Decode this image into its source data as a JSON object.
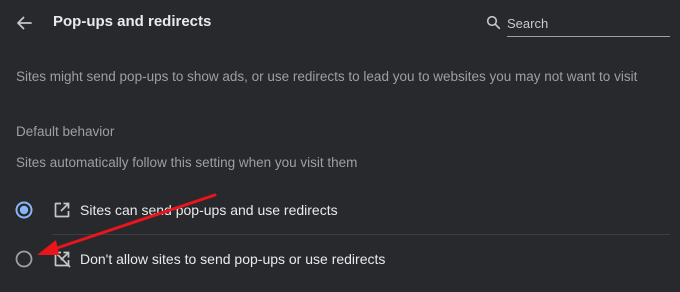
{
  "header": {
    "title": "Pop-ups and redirects",
    "back_icon": "arrow-back-icon"
  },
  "search": {
    "placeholder": "Search",
    "value": "",
    "icon": "search-icon"
  },
  "description": "Sites might send pop-ups to show ads, or use redirects to lead you to websites you may not want to visit",
  "default_behavior": {
    "heading": "Default behavior",
    "subtitle": "Sites automatically follow this setting when you visit them",
    "options": [
      {
        "label": "Sites can send pop-ups and use redirects",
        "icon": "open-in-new-icon",
        "selected": true
      },
      {
        "label": "Don't allow sites to send pop-ups or use redirects",
        "icon": "blocked-open-in-new-icon",
        "selected": false
      }
    ]
  },
  "colors": {
    "background": "#28292c",
    "accent": "#8ab4f8",
    "text_primary": "#e8eaed",
    "text_secondary": "#9aa0a6",
    "annotation": "#e8151b"
  }
}
